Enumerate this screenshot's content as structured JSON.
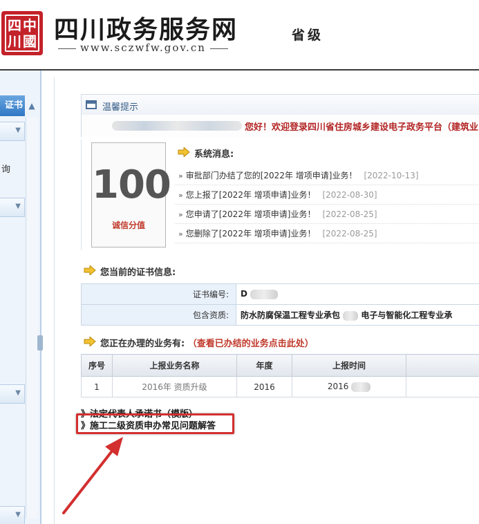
{
  "header": {
    "seal_glyphs": [
      "四",
      "川",
      "中",
      "國"
    ],
    "site_title": "四川政务服务网",
    "site_url": "www.sczwfw.gov.cn",
    "level": "省级"
  },
  "sidebar": {
    "top_label": "证书",
    "text_item": "询"
  },
  "tip": {
    "label": "温馨提示",
    "welcome": "您好！欢迎登录四川省住房城乡建设电子政务平台（建筑业"
  },
  "score": {
    "value": "100",
    "label": "诚信分值"
  },
  "system_messages": {
    "title": "系统消息:",
    "items": [
      {
        "text": "审批部门办结了您的[2022年 增项申请]业务！",
        "date": "[2022-10-13]"
      },
      {
        "text": "您上报了[2022年 增项申请]业务！",
        "date": "[2022-08-30]"
      },
      {
        "text": "您申请了[2022年 增项申请]业务！",
        "date": "[2022-08-25]"
      },
      {
        "text": "您删除了[2022年 增项申请]业务！",
        "date": "[2022-08-25]"
      }
    ]
  },
  "certificate": {
    "title": "您当前的证书信息:",
    "rows": [
      {
        "key": "证书编号:",
        "value": "D"
      },
      {
        "key": "包含资质:",
        "value_a": "防水防腐保温工程专业承包",
        "value_b": "电子与智能化工程专业承"
      }
    ]
  },
  "business": {
    "title": "您正在办理的业务有:",
    "link": "（查看已办结的业务点击此处）",
    "columns": [
      "序号",
      "上报业务名称",
      "年度",
      "上报时间"
    ],
    "rows": [
      {
        "no": "1",
        "name": "2016年 资质升级",
        "year": "2016",
        "time": "2016"
      }
    ]
  },
  "links": {
    "commitment": "》法定代表人承诺书（模版）",
    "faq": "》施工二级资质申办常见问题解答"
  }
}
